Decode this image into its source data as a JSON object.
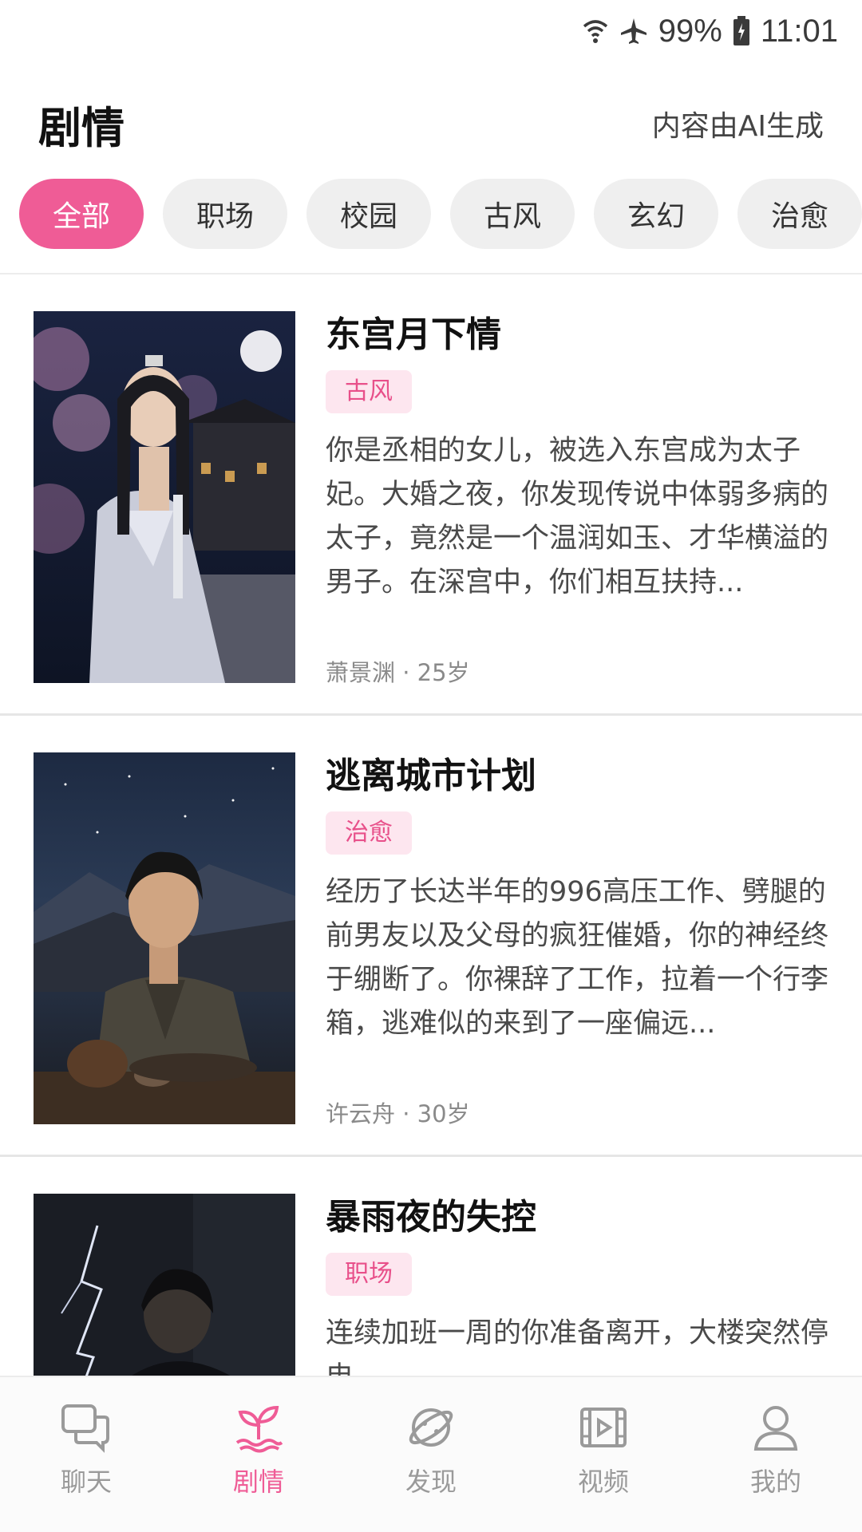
{
  "status_bar": {
    "battery": "99%",
    "time": "11:01",
    "icons": [
      "wifi-icon",
      "airplane-icon",
      "battery-icon"
    ]
  },
  "header": {
    "title": "剧情",
    "ai_note": "内容由AI生成"
  },
  "filters": {
    "chips": [
      "全部",
      "职场",
      "校园",
      "古风",
      "玄幻",
      "治愈"
    ],
    "active_index": 0
  },
  "stories": [
    {
      "title": "东宫月下情",
      "genre": "古风",
      "description": "你是丞相的女儿，被选入东宫成为太子妃。大婚之夜，你发现传说中体弱多病的太子，竟然是一个温润如玉、才华横溢的男子。在深宫中，你们相互扶持...",
      "meta": "萧景渊 · 25岁"
    },
    {
      "title": "逃离城市计划",
      "genre": "治愈",
      "description": "经历了长达半年的996高压工作、劈腿的前男友以及父母的疯狂催婚，你的神经终于绷断了。你裸辞了工作，拉着一个行李箱，逃难似的来到了一座偏远...",
      "meta": "许云舟 · 30岁"
    },
    {
      "title": "暴雨夜的失控",
      "genre": "职场",
      "description": "连续加班一周的你准备离开，大楼突然停电，..."
    }
  ],
  "bottom_nav": {
    "items": [
      {
        "label": "聊天",
        "icon": "chat-icon"
      },
      {
        "label": "剧情",
        "icon": "sprout-icon"
      },
      {
        "label": "发现",
        "icon": "planet-icon"
      },
      {
        "label": "视频",
        "icon": "video-icon"
      },
      {
        "label": "我的",
        "icon": "profile-icon"
      }
    ],
    "active_index": 1
  },
  "colors": {
    "accent": "#ef5c96",
    "badge_bg": "#fde6ef",
    "badge_text": "#e8508a"
  }
}
